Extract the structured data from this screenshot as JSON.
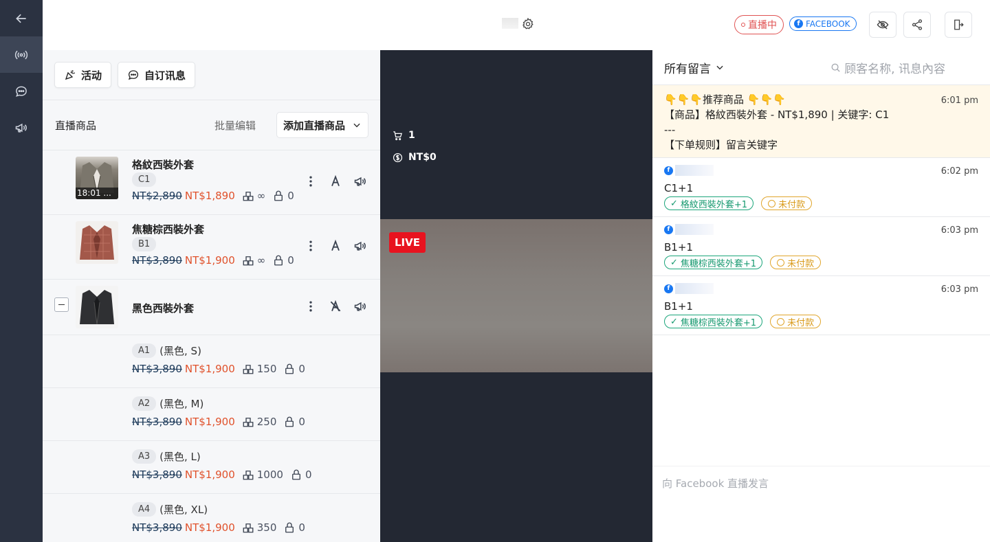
{
  "rail": {
    "items": [
      "back-arrow-icon",
      "live-broadcast-icon",
      "chat-bubble-icon",
      "megaphone-icon"
    ]
  },
  "topbar": {
    "live_label": "直播中",
    "fb_label": "FACEBOOK"
  },
  "panel": {
    "activity_label": "活动",
    "custom_msg_label": "自订讯息",
    "list_title": "直播商品",
    "bulk_edit_label": "批量编辑",
    "add_label": "添加直播商品",
    "products": [
      {
        "name": "格紋西裝外套",
        "code": "C1",
        "old_price": "NT$2,890",
        "new_price": "NT$1,890",
        "stock": "∞",
        "locked": "0",
        "thumb_time": "18:01 ..."
      },
      {
        "name": "焦糖棕西裝外套",
        "code": "B1",
        "old_price": "NT$3,890",
        "new_price": "NT$1,900",
        "stock": "∞",
        "locked": "0"
      },
      {
        "name": "黑色西裝外套"
      }
    ],
    "variants": [
      {
        "code": "A1",
        "spec": "(黑色, S)",
        "old_price": "NT$3,890",
        "new_price": "NT$1,900",
        "stock": "150",
        "locked": "0"
      },
      {
        "code": "A2",
        "spec": "(黑色, M)",
        "old_price": "NT$3,890",
        "new_price": "NT$1,900",
        "stock": "250",
        "locked": "0"
      },
      {
        "code": "A3",
        "spec": "(黑色, L)",
        "old_price": "NT$3,890",
        "new_price": "NT$1,900",
        "stock": "1000",
        "locked": "0"
      },
      {
        "code": "A4",
        "spec": "(黑色, XL)",
        "old_price": "NT$3,890",
        "new_price": "NT$1,900",
        "stock": "350",
        "locked": "0"
      }
    ]
  },
  "video": {
    "cart_count": "1",
    "total": "NT$0",
    "live_tag": "LIVE"
  },
  "comments": {
    "filter_label": "所有留言",
    "search_placeholder": "顾客名称, 讯息內容",
    "pinned": {
      "line1": "👇👇👇推荐商品 👇👇👇",
      "line2": "【商品】格紋西裝外套 - NT$1,890 | 关键字: C1",
      "line3": "---",
      "line4": "【下单规则】留言关键字",
      "time": "6:01 pm"
    },
    "items": [
      {
        "time": "6:02 pm",
        "text": "C1+1",
        "tag_product": "格紋西裝外套+1",
        "tag_status": "未付款"
      },
      {
        "time": "6:03 pm",
        "text": "B1+1",
        "tag_product": "焦糖棕西裝外套+1",
        "tag_status": "未付款"
      },
      {
        "time": "6:03 pm",
        "text": "B1+1",
        "tag_product": "焦糖棕西裝外套+1",
        "tag_status": "未付款"
      }
    ],
    "composer_placeholder": "向 Facebook 直播发言"
  }
}
